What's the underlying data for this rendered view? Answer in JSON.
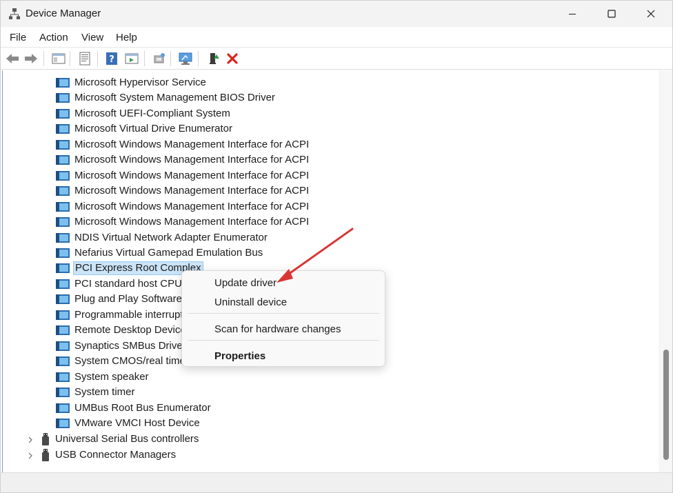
{
  "window": {
    "title": "Device Manager"
  },
  "menu": [
    "File",
    "Action",
    "View",
    "Help"
  ],
  "toolbar": [
    "back-icon",
    "forward-icon",
    "show-hide-console-tree-icon",
    "properties-icon",
    "help-icon",
    "action-pane-icon",
    "update-driver-icon",
    "scan-hardware-icon",
    "enable-device-icon",
    "uninstall-icon"
  ],
  "devices": [
    "Microsoft Hypervisor Service",
    "Microsoft System Management BIOS Driver",
    "Microsoft UEFI-Compliant System",
    "Microsoft Virtual Drive Enumerator",
    "Microsoft Windows Management Interface for ACPI",
    "Microsoft Windows Management Interface for ACPI",
    "Microsoft Windows Management Interface for ACPI",
    "Microsoft Windows Management Interface for ACPI",
    "Microsoft Windows Management Interface for ACPI",
    "Microsoft Windows Management Interface for ACPI",
    "NDIS Virtual Network Adapter Enumerator",
    "Nefarius Virtual Gamepad Emulation Bus",
    "PCI Express Root Complex",
    "PCI standard host CPU b",
    "Plug and Play Software D",
    "Programmable interrupt",
    "Remote Desktop Device",
    "Synaptics SMBus Driver",
    "System CMOS/real time c",
    "System speaker",
    "System timer",
    "UMBus Root Bus Enumerator",
    "VMware VMCI Host Device"
  ],
  "selected_device": "PCI Express Root Complex",
  "categories": [
    "Universal Serial Bus controllers",
    "USB Connector Managers"
  ],
  "context_menu": {
    "update": "Update driver",
    "uninstall": "Uninstall device",
    "scan": "Scan for hardware changes",
    "properties": "Properties"
  },
  "colors": {
    "selection": "#cce4f7",
    "annotation_arrow": "#d93535"
  }
}
